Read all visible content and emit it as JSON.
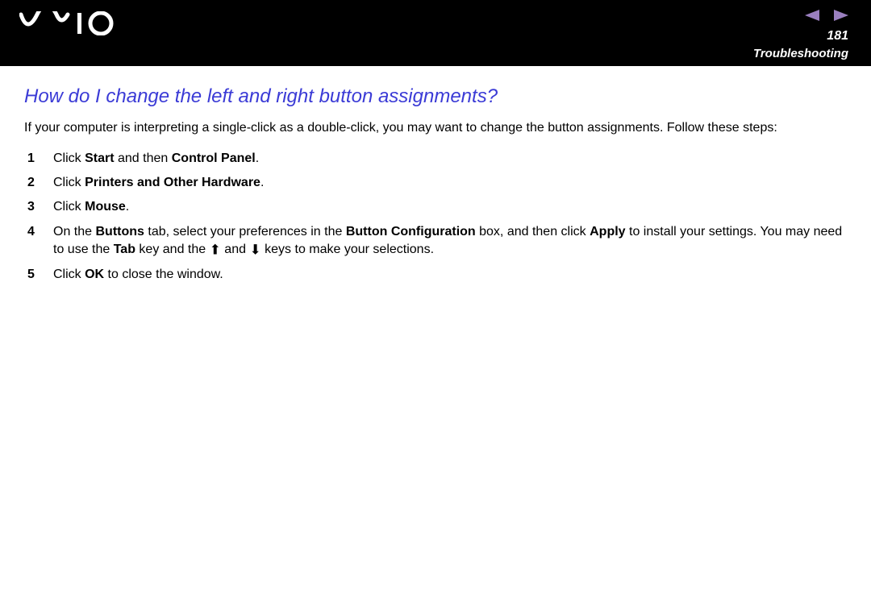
{
  "header": {
    "page_number": "181",
    "section": "Troubleshooting"
  },
  "title": "How do I change the left and right button assignments?",
  "intro": "If your computer is interpreting a single-click as a double-click, you may want to change the button assignments. Follow these steps:",
  "steps": {
    "s1": {
      "a": "Click ",
      "b1": "Start",
      "c": " and then ",
      "b2": "Control Panel",
      "d": "."
    },
    "s2": {
      "a": "Click ",
      "b1": "Printers and Other Hardware",
      "c": "."
    },
    "s3": {
      "a": "Click ",
      "b1": "Mouse",
      "c": "."
    },
    "s4": {
      "a": "On the ",
      "b1": "Buttons",
      "c": " tab, select your preferences in the ",
      "b2": "Button Configuration",
      "d": " box, and then click ",
      "b3": "Apply",
      "e": " to install your settings. You may need to use the ",
      "b4": "Tab",
      "f": " key and the ",
      "up": "⬆",
      "g": " and ",
      "down": "⬇",
      "h": " keys to make your selections."
    },
    "s5": {
      "a": "Click ",
      "b1": "OK",
      "c": " to close the window."
    }
  }
}
